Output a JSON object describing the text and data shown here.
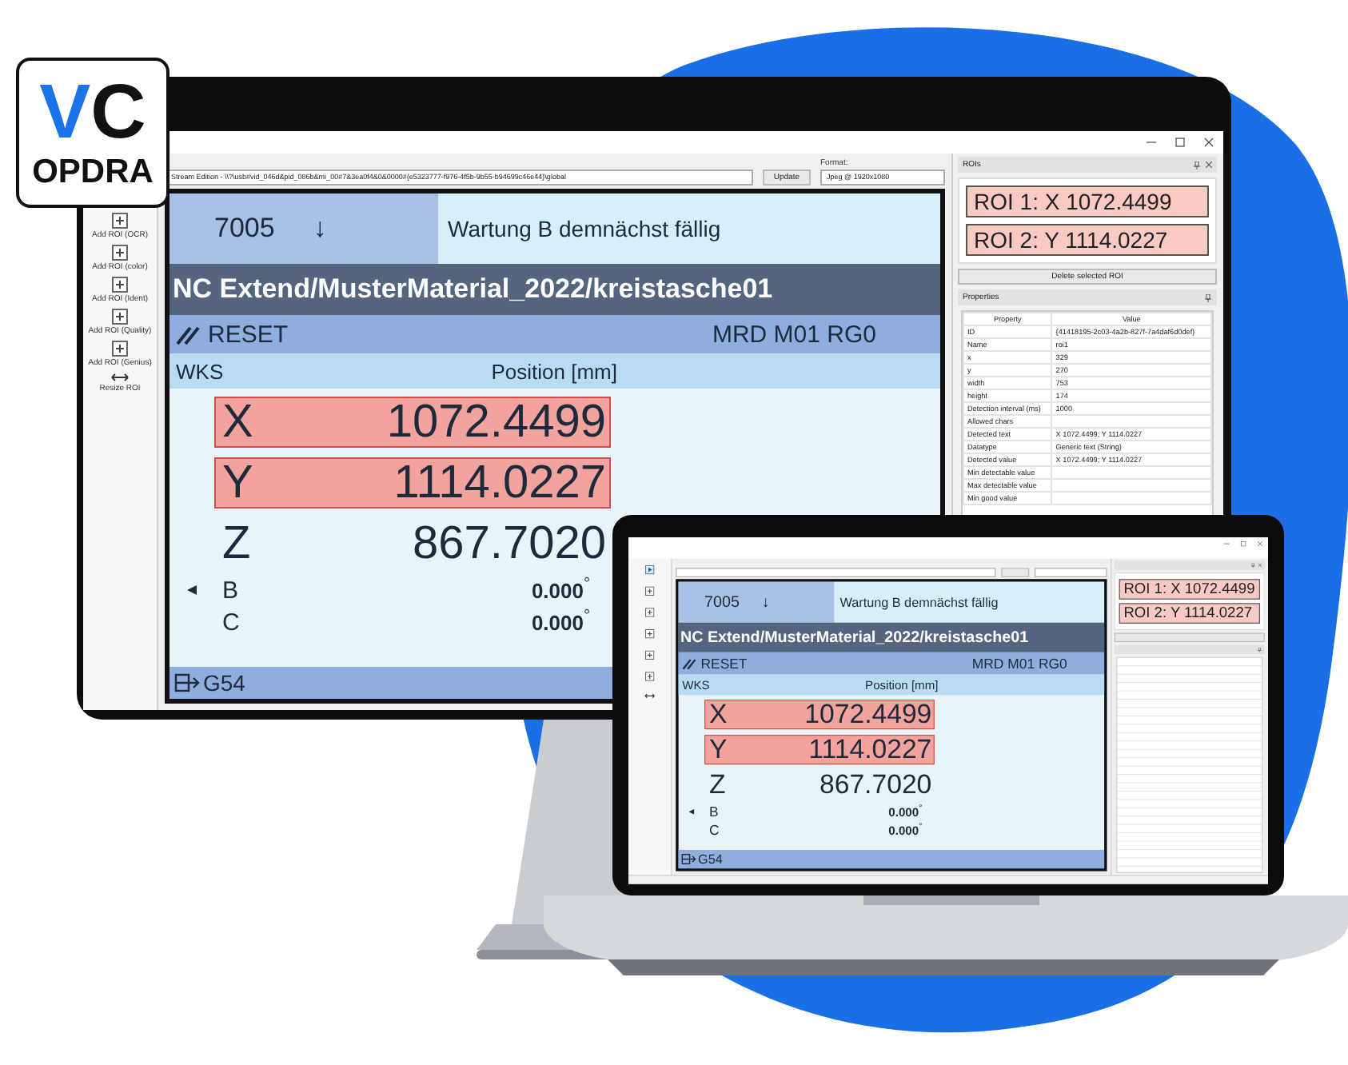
{
  "logo": {
    "mark_left": "V",
    "mark_right": "C",
    "name": "OPDRA"
  },
  "monitor": {
    "toolbar": [
      {
        "kind": "add",
        "label": "Add ROI (OCR)"
      },
      {
        "kind": "add",
        "label": "Add ROI (color)"
      },
      {
        "kind": "add",
        "label": "Add ROI (Ident)"
      },
      {
        "kind": "add",
        "label": "Add ROI (Quality)"
      },
      {
        "kind": "add",
        "label": "Add ROI (Genius)"
      },
      {
        "kind": "resize",
        "label": "Resize ROI"
      }
    ],
    "source": {
      "value": "Stream Edition - \\\\?\\usb#vid_046d&pid_086b&mi_00#7&3ea0f4&0&0000#{e5323777-f976-4f5b-9b55-b94699c46e44}\\global",
      "button": "Update",
      "format_label": "Format:",
      "format_value": "Jpeg @ 1920x1080"
    },
    "cnc": {
      "alarm_number": "7005",
      "alarm_arrow": "↓",
      "alarm_text": "Wartung B demnächst fällig",
      "program": "NC Extend/MusterMaterial_2022/kreistasche01",
      "mode": "RESET",
      "status": "MRD M01 RG0",
      "frame_label": "WKS",
      "position_label": "Position [mm]",
      "axes": [
        {
          "kind": "linear",
          "name": "X",
          "value": "1072.4499",
          "highlighted": true,
          "marker": false
        },
        {
          "kind": "linear",
          "name": "Y",
          "value": "1114.0227",
          "highlighted": true,
          "marker": false
        },
        {
          "kind": "linear",
          "name": "Z",
          "value": "867.7020",
          "highlighted": false,
          "marker": false
        },
        {
          "kind": "rotary",
          "name": "B",
          "value": "0.000",
          "unit": "°",
          "highlighted": false,
          "marker": true
        },
        {
          "kind": "rotary",
          "name": "C",
          "value": "0.000",
          "unit": "°",
          "highlighted": false,
          "marker": false
        }
      ],
      "work_offset": "G54"
    },
    "rois": {
      "title": "ROIs",
      "items": [
        "ROI 1: X 1072.4499",
        "ROI 2: Y 1114.0227"
      ],
      "delete_button": "Delete selected ROI"
    },
    "properties": {
      "title": "Properties",
      "columns": [
        "Property",
        "Value"
      ],
      "rows": [
        [
          "ID",
          "{41418195-2c03-4a2b-827f-7a4daf6d0def}"
        ],
        [
          "Name",
          "roi1"
        ],
        [
          "x",
          "329"
        ],
        [
          "y",
          "270"
        ],
        [
          "width",
          "753"
        ],
        [
          "height",
          "174"
        ],
        [
          "Detection interval (ms)",
          "1000"
        ],
        [
          "Allowed chars",
          ""
        ],
        [
          "Detected text",
          "X 1072.4499; Y 1114.0227"
        ],
        [
          "Datatype",
          "Generic text (String)"
        ],
        [
          "Detected value",
          "X 1072.4499; Y 1114.0227"
        ],
        [
          "Min detectable value",
          ""
        ],
        [
          "Max detectable value",
          ""
        ],
        [
          "Min good value",
          ""
        ]
      ]
    }
  },
  "laptop": {
    "toolbar": [
      {
        "kind": "play"
      },
      {
        "kind": "add"
      },
      {
        "kind": "add"
      },
      {
        "kind": "add"
      },
      {
        "kind": "add"
      },
      {
        "kind": "add"
      },
      {
        "kind": "resize"
      }
    ],
    "cnc": {
      "alarm_number": "7005",
      "alarm_arrow": "↓",
      "alarm_text": "Wartung B demnächst fällig",
      "program": "NC Extend/MusterMaterial_2022/kreistasche01",
      "mode": "RESET",
      "status": "MRD M01 RG0",
      "frame_label": "WKS",
      "position_label": "Position [mm]",
      "axes": [
        {
          "kind": "linear",
          "name": "X",
          "value": "1072.4499",
          "highlighted": true,
          "marker": false
        },
        {
          "kind": "linear",
          "name": "Y",
          "value": "1114.0227",
          "highlighted": true,
          "marker": false
        },
        {
          "kind": "linear",
          "name": "Z",
          "value": "867.7020",
          "highlighted": false,
          "marker": false
        },
        {
          "kind": "rotary",
          "name": "B",
          "value": "0.000",
          "unit": "°",
          "highlighted": false,
          "marker": true
        },
        {
          "kind": "rotary",
          "name": "C",
          "value": "0.000",
          "unit": "°",
          "highlighted": false,
          "marker": false
        }
      ],
      "work_offset": "G54"
    },
    "rois": {
      "items": [
        "ROI 1: X 1072.4499",
        "ROI 2: Y 1114.0227"
      ]
    }
  }
}
